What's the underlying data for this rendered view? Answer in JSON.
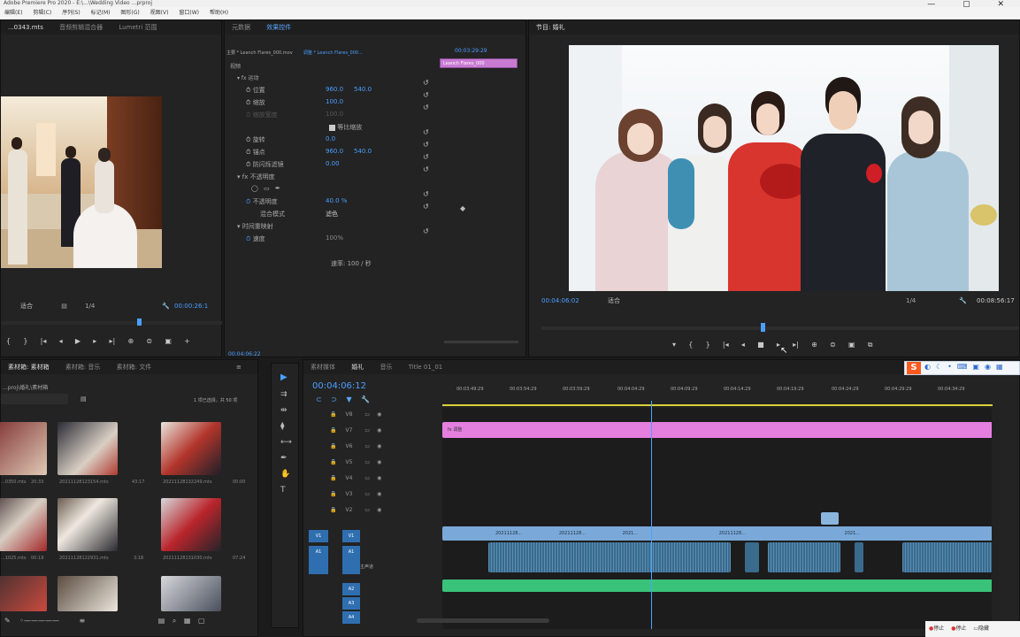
{
  "app": {
    "title": "Adobe Premiere Pro 2020 - E:\\...\\Wedding Video ...prproj"
  },
  "menu": [
    "编辑(E)",
    "剪辑(C)",
    "序列(S)",
    "标记(M)",
    "图形(G)",
    "视图(V)",
    "窗口(W)",
    "帮助(H)"
  ],
  "source_panel": {
    "tabs": [
      "...0343.mts",
      "音频剪辑混合器",
      "Lumetri 范围"
    ],
    "fit": "适合",
    "resolution": "1/4",
    "timecode": "00:00:26:1"
  },
  "effect_controls": {
    "tabs": [
      "元数据",
      "效果控件"
    ],
    "source_clip": "主要 * Leanch Flares_000.mov",
    "sequence_clip": "调整 * Leanch Flares_000...",
    "ruler_time": "00:03:29:29",
    "clip_label": "Leanch Flares_000",
    "section_video": "视频",
    "motion_group": "运动",
    "properties": [
      {
        "name": "位置",
        "v1": "960.0",
        "v2": "540.0"
      },
      {
        "name": "缩放",
        "v1": "100.0",
        "v2": ""
      },
      {
        "name": "缩放宽度",
        "v1": "100.0",
        "v2": ""
      },
      {
        "name": "等比缩放",
        "v1": "",
        "v2": ""
      },
      {
        "name": "旋转",
        "v1": "0.0",
        "v2": ""
      },
      {
        "name": "锚点",
        "v1": "960.0",
        "v2": "540.0"
      },
      {
        "name": "防闪烁滤镜",
        "v1": "0.00",
        "v2": ""
      },
      {
        "name": "不透明度",
        "v1": "",
        "v2": ""
      },
      {
        "name": "不透明度",
        "v1": "40.0 %",
        "v2": ""
      },
      {
        "name": "混合模式",
        "v1": "滤色",
        "v2": ""
      },
      {
        "name": "时间重映射",
        "v1": "",
        "v2": ""
      },
      {
        "name": "速度",
        "v1": "100%",
        "v2": ""
      }
    ],
    "speed_label": "速率: 100 / 秒",
    "bottom_time": "00:04:06:22"
  },
  "program_panel": {
    "tab": "节目: 婚礼",
    "timecode": "00:04:06:02",
    "fit": "适合",
    "resolution": "1/4",
    "duration": "00:08:56:17"
  },
  "project_panel": {
    "tabs": [
      "素材箱: 素材箱",
      "素材箱: 音乐",
      "素材箱: 文件"
    ],
    "path": "...proj\\婚礼\\素材箱",
    "selection": "1 项已选择，共 50 项",
    "items": [
      {
        "name": "...0350.mts",
        "dur": "20:33"
      },
      {
        "name": "20211128123154.mts",
        "dur": "43:17"
      },
      {
        "name": "20211128132249.mts",
        "dur": "00:00"
      },
      {
        "name": "...1025.mts",
        "dur": "00:19"
      },
      {
        "name": "20211128122931.mts",
        "dur": "3:18"
      },
      {
        "name": "20211128131030.mts",
        "dur": "07:24"
      },
      {
        "name": "...",
        "dur": ""
      },
      {
        "name": "...",
        "dur": ""
      },
      {
        "name": "...",
        "dur": ""
      }
    ]
  },
  "timeline": {
    "tabs": [
      "素材媒体",
      "婚礼",
      "音乐",
      "Title 01_01"
    ],
    "timecode": "00:04:06:12",
    "ruler": [
      "00:03:49:29",
      "00:03:54:29",
      "00:03:59:29",
      "00:04:04:29",
      "00:04:09:29",
      "00:04:14:29",
      "00:04:19:29",
      "00:04:24:29",
      "00:04:29:29",
      "00:04:34:29"
    ],
    "tracks": [
      "V8",
      "V7",
      "V6",
      "V5",
      "V4",
      "V3",
      "V2",
      "V1",
      "A1",
      "A2",
      "A3",
      "A4"
    ],
    "adjust_clip": "调整",
    "v1_clips": [
      "20211128...",
      "20211128...",
      "2021...",
      "20211128...",
      "2021..."
    ],
    "mix_label": "主声道"
  },
  "tray": {
    "ime": "S",
    "labels": [
      "中",
      "英",
      "简",
      "繁"
    ],
    "bottom": [
      "停止",
      "停止",
      "隐藏"
    ]
  },
  "colors": {
    "accent": "#2f8cff",
    "adjust_clip": "#e47fe0",
    "video_clip": "#7aa9d9",
    "audio_clip": "#3a6a8c",
    "music_clip": "#39c27a",
    "playhead": "#4aa3ff"
  }
}
